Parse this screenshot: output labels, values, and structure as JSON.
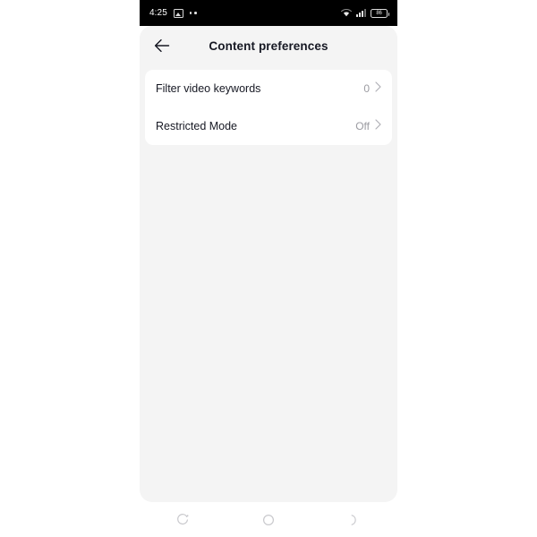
{
  "status_bar": {
    "time": "4:25",
    "photo_icon": "photo-icon",
    "dots_icon": "dots-icon",
    "wifi_icon": "wifi-icon",
    "signal_icon": "signal-icon",
    "battery_icon": "battery-icon",
    "battery_level": "86"
  },
  "header": {
    "back_icon": "back-arrow-icon",
    "title": "Content preferences"
  },
  "settings": {
    "rows": [
      {
        "label": "Filter video keywords",
        "value": "0",
        "chevron_icon": "chevron-right-icon"
      },
      {
        "label": "Restricted Mode",
        "value": "Off",
        "chevron_icon": "chevron-right-icon"
      }
    ]
  },
  "nav_bar": {
    "recents_label": "recents-icon",
    "home_label": "home-icon",
    "back_label": "back-icon"
  },
  "colors": {
    "status_bar_bg": "#000000",
    "screen_bg": "#f4f4f4",
    "card_bg": "#ffffff",
    "primary_text": "#161823",
    "secondary_text": "#9b9ba1"
  }
}
